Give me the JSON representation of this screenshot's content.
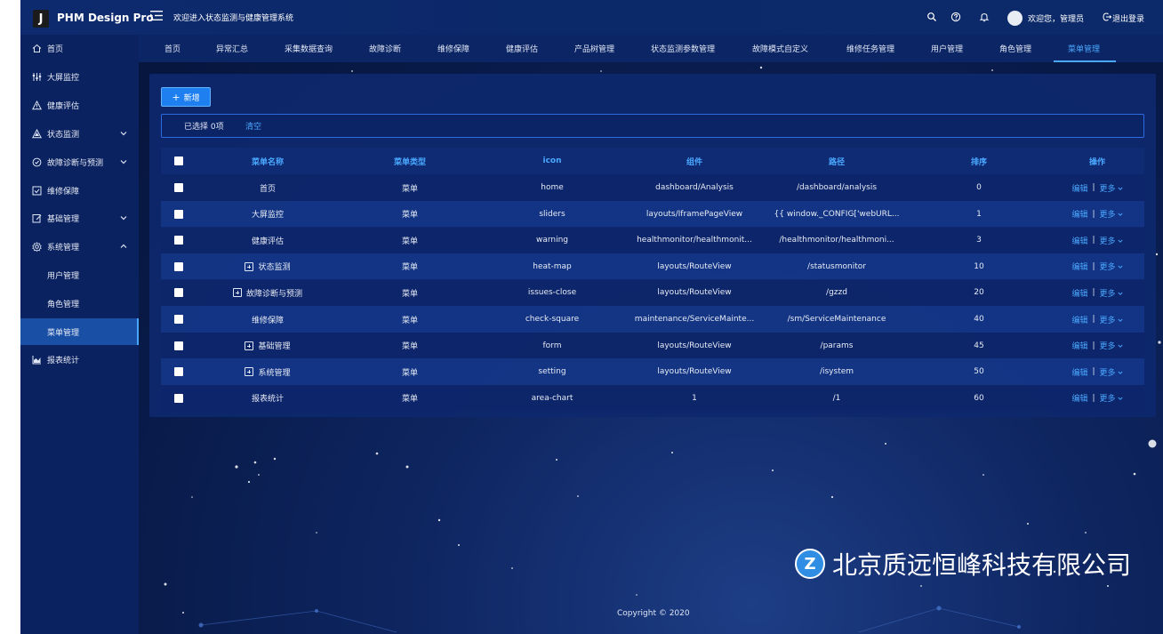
{
  "header": {
    "logo_letter": "J",
    "app_title": "PHM Design Pro",
    "welcome": "欢迎进入状态监测与健康管理系统",
    "user_greeting": "欢迎您，管理员",
    "logout": "退出登录"
  },
  "sidebar": {
    "items": [
      {
        "label": "首页",
        "icon": "home-icon"
      },
      {
        "label": "大屏监控",
        "icon": "sliders-icon"
      },
      {
        "label": "健康评估",
        "icon": "warning-icon"
      },
      {
        "label": "状态监测",
        "icon": "heat-map-icon",
        "arrow": "down"
      },
      {
        "label": "故障诊断与预测",
        "icon": "issues-close-icon",
        "arrow": "down"
      },
      {
        "label": "维修保障",
        "icon": "check-square-icon"
      },
      {
        "label": "基础管理",
        "icon": "form-icon",
        "arrow": "down"
      },
      {
        "label": "系统管理",
        "icon": "setting-icon",
        "arrow": "up"
      },
      {
        "label": "用户管理",
        "sub": true
      },
      {
        "label": "角色管理",
        "sub": true
      },
      {
        "label": "菜单管理",
        "sub": true,
        "active": true
      },
      {
        "label": "报表统计",
        "icon": "area-chart-icon"
      }
    ]
  },
  "topnav": {
    "tabs": [
      "首页",
      "异常汇总",
      "采集数据查询",
      "故障诊断",
      "维修保障",
      "健康评估",
      "产品树管理",
      "状态监测参数管理",
      "故障模式自定义",
      "维修任务管理",
      "用户管理",
      "角色管理",
      "菜单管理"
    ],
    "active": "菜单管理"
  },
  "toolbar": {
    "add_label": "新增",
    "selected_text": "已选择 0项",
    "clear_label": "清空"
  },
  "table": {
    "headers": [
      "菜单名称",
      "菜单类型",
      "icon",
      "组件",
      "路径",
      "排序",
      "操作"
    ],
    "edit_label": "编辑",
    "more_label": "更多",
    "rows": [
      {
        "name": "首页",
        "type": "菜单",
        "icon": "home",
        "component": "dashboard/Analysis",
        "path": "/dashboard/analysis",
        "order": "0",
        "expandable": false
      },
      {
        "name": "大屏监控",
        "type": "菜单",
        "icon": "sliders",
        "component": "layouts/IframePageView",
        "path": "{{ window._CONFIG['webURL...",
        "order": "1",
        "expandable": false
      },
      {
        "name": "健康评估",
        "type": "菜单",
        "icon": "warning",
        "component": "healthmonitor/healthmonit...",
        "path": "/healthmonitor/healthmoni...",
        "order": "3",
        "expandable": false
      },
      {
        "name": "状态监测",
        "type": "菜单",
        "icon": "heat-map",
        "component": "layouts/RouteView",
        "path": "/statusmonitor",
        "order": "10",
        "expandable": true
      },
      {
        "name": "故障诊断与预测",
        "type": "菜单",
        "icon": "issues-close",
        "component": "layouts/RouteView",
        "path": "/gzzd",
        "order": "20",
        "expandable": true
      },
      {
        "name": "维修保障",
        "type": "菜单",
        "icon": "check-square",
        "component": "maintenance/ServiceMainte...",
        "path": "/sm/ServiceMaintenance",
        "order": "40",
        "expandable": false
      },
      {
        "name": "基础管理",
        "type": "菜单",
        "icon": "form",
        "component": "layouts/RouteView",
        "path": "/params",
        "order": "45",
        "expandable": true
      },
      {
        "name": "系统管理",
        "type": "菜单",
        "icon": "setting",
        "component": "layouts/RouteView",
        "path": "/isystem",
        "order": "50",
        "expandable": true
      },
      {
        "name": "报表统计",
        "type": "菜单",
        "icon": "area-chart",
        "component": "1",
        "path": "/1",
        "order": "60",
        "expandable": false
      }
    ]
  },
  "footer": {
    "copyright": "Copyright © 2020"
  },
  "watermark": {
    "company": "北京质远恒峰科技有限公司"
  },
  "colors": {
    "accent": "#4aa8ff",
    "primary_button": "#1e7ff0",
    "sidebar_bg": "#0b2260",
    "header_bg": "#0d2a6e"
  }
}
